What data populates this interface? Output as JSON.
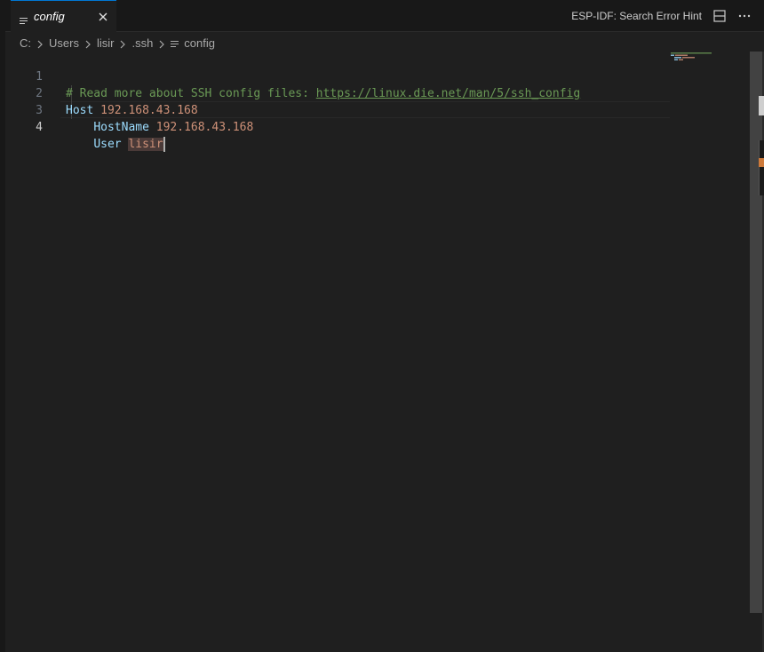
{
  "tab": {
    "label": "config",
    "file_icon": "lines-file-icon",
    "close_icon": "close-icon"
  },
  "toolbar": {
    "esp_hint": "ESP-IDF: Search Error Hint",
    "split_icon": "split-editor-icon",
    "more_icon": "more-actions-icon"
  },
  "breadcrumb": {
    "items": [
      "C:",
      "Users",
      "lisir",
      ".ssh",
      "config"
    ]
  },
  "editor": {
    "lines": [
      {
        "number": "1",
        "comment": "# Read more about SSH config files: ",
        "link": "https://linux.die.net/man/5/ssh_config"
      },
      {
        "number": "2",
        "keyword": "Host",
        "value": "192.168.43.168"
      },
      {
        "number": "3",
        "keyword": "HostName",
        "value": "192.168.43.168"
      },
      {
        "number": "4",
        "keyword": "User",
        "value": "lisir"
      }
    ],
    "active_line": 4
  },
  "colors": {
    "background": "#1f1f1f",
    "tab_bar": "#181818",
    "comment": "#6a9955",
    "keyword": "#9cdcfe",
    "value": "#ce9178",
    "accent": "#0078d4"
  }
}
